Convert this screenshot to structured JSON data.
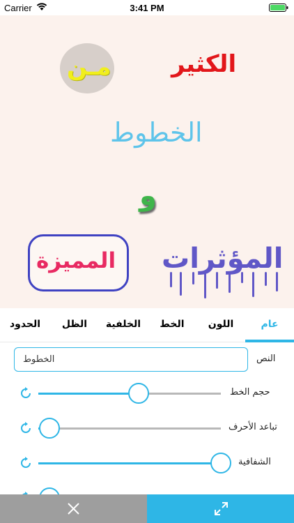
{
  "status_bar": {
    "carrier": "Carrier",
    "time": "3:41 PM"
  },
  "canvas": {
    "background": "#fcf2ed",
    "stickers": {
      "kathir": "الكثير",
      "min": "مـن",
      "khutut": "الخطوط",
      "waw": "و",
      "muamizza": "المميزة",
      "muaththirat": "المؤثرات"
    }
  },
  "tabs": [
    {
      "label": "عام",
      "active": true
    },
    {
      "label": "اللون",
      "active": false
    },
    {
      "label": "الخط",
      "active": false
    },
    {
      "label": "الخلفية",
      "active": false
    },
    {
      "label": "الظل",
      "active": false
    },
    {
      "label": "الحدود",
      "active": false
    }
  ],
  "panel": {
    "text_label": "النص",
    "text_value": "الخطوط",
    "sliders": [
      {
        "label": "حجم الخط",
        "value": 0.55
      },
      {
        "label": "تباعد الأحرف",
        "value": 0.06
      },
      {
        "label": "الشفافية",
        "value": 1.0
      },
      {
        "label": "",
        "value": 0.06
      }
    ]
  },
  "bottom_bar": {
    "close_icon": "close-icon",
    "expand_icon": "expand-icon"
  },
  "colors": {
    "accent": "#2eb6e6",
    "close_bg": "#9e9e9e",
    "track": "#b8b8b8"
  }
}
